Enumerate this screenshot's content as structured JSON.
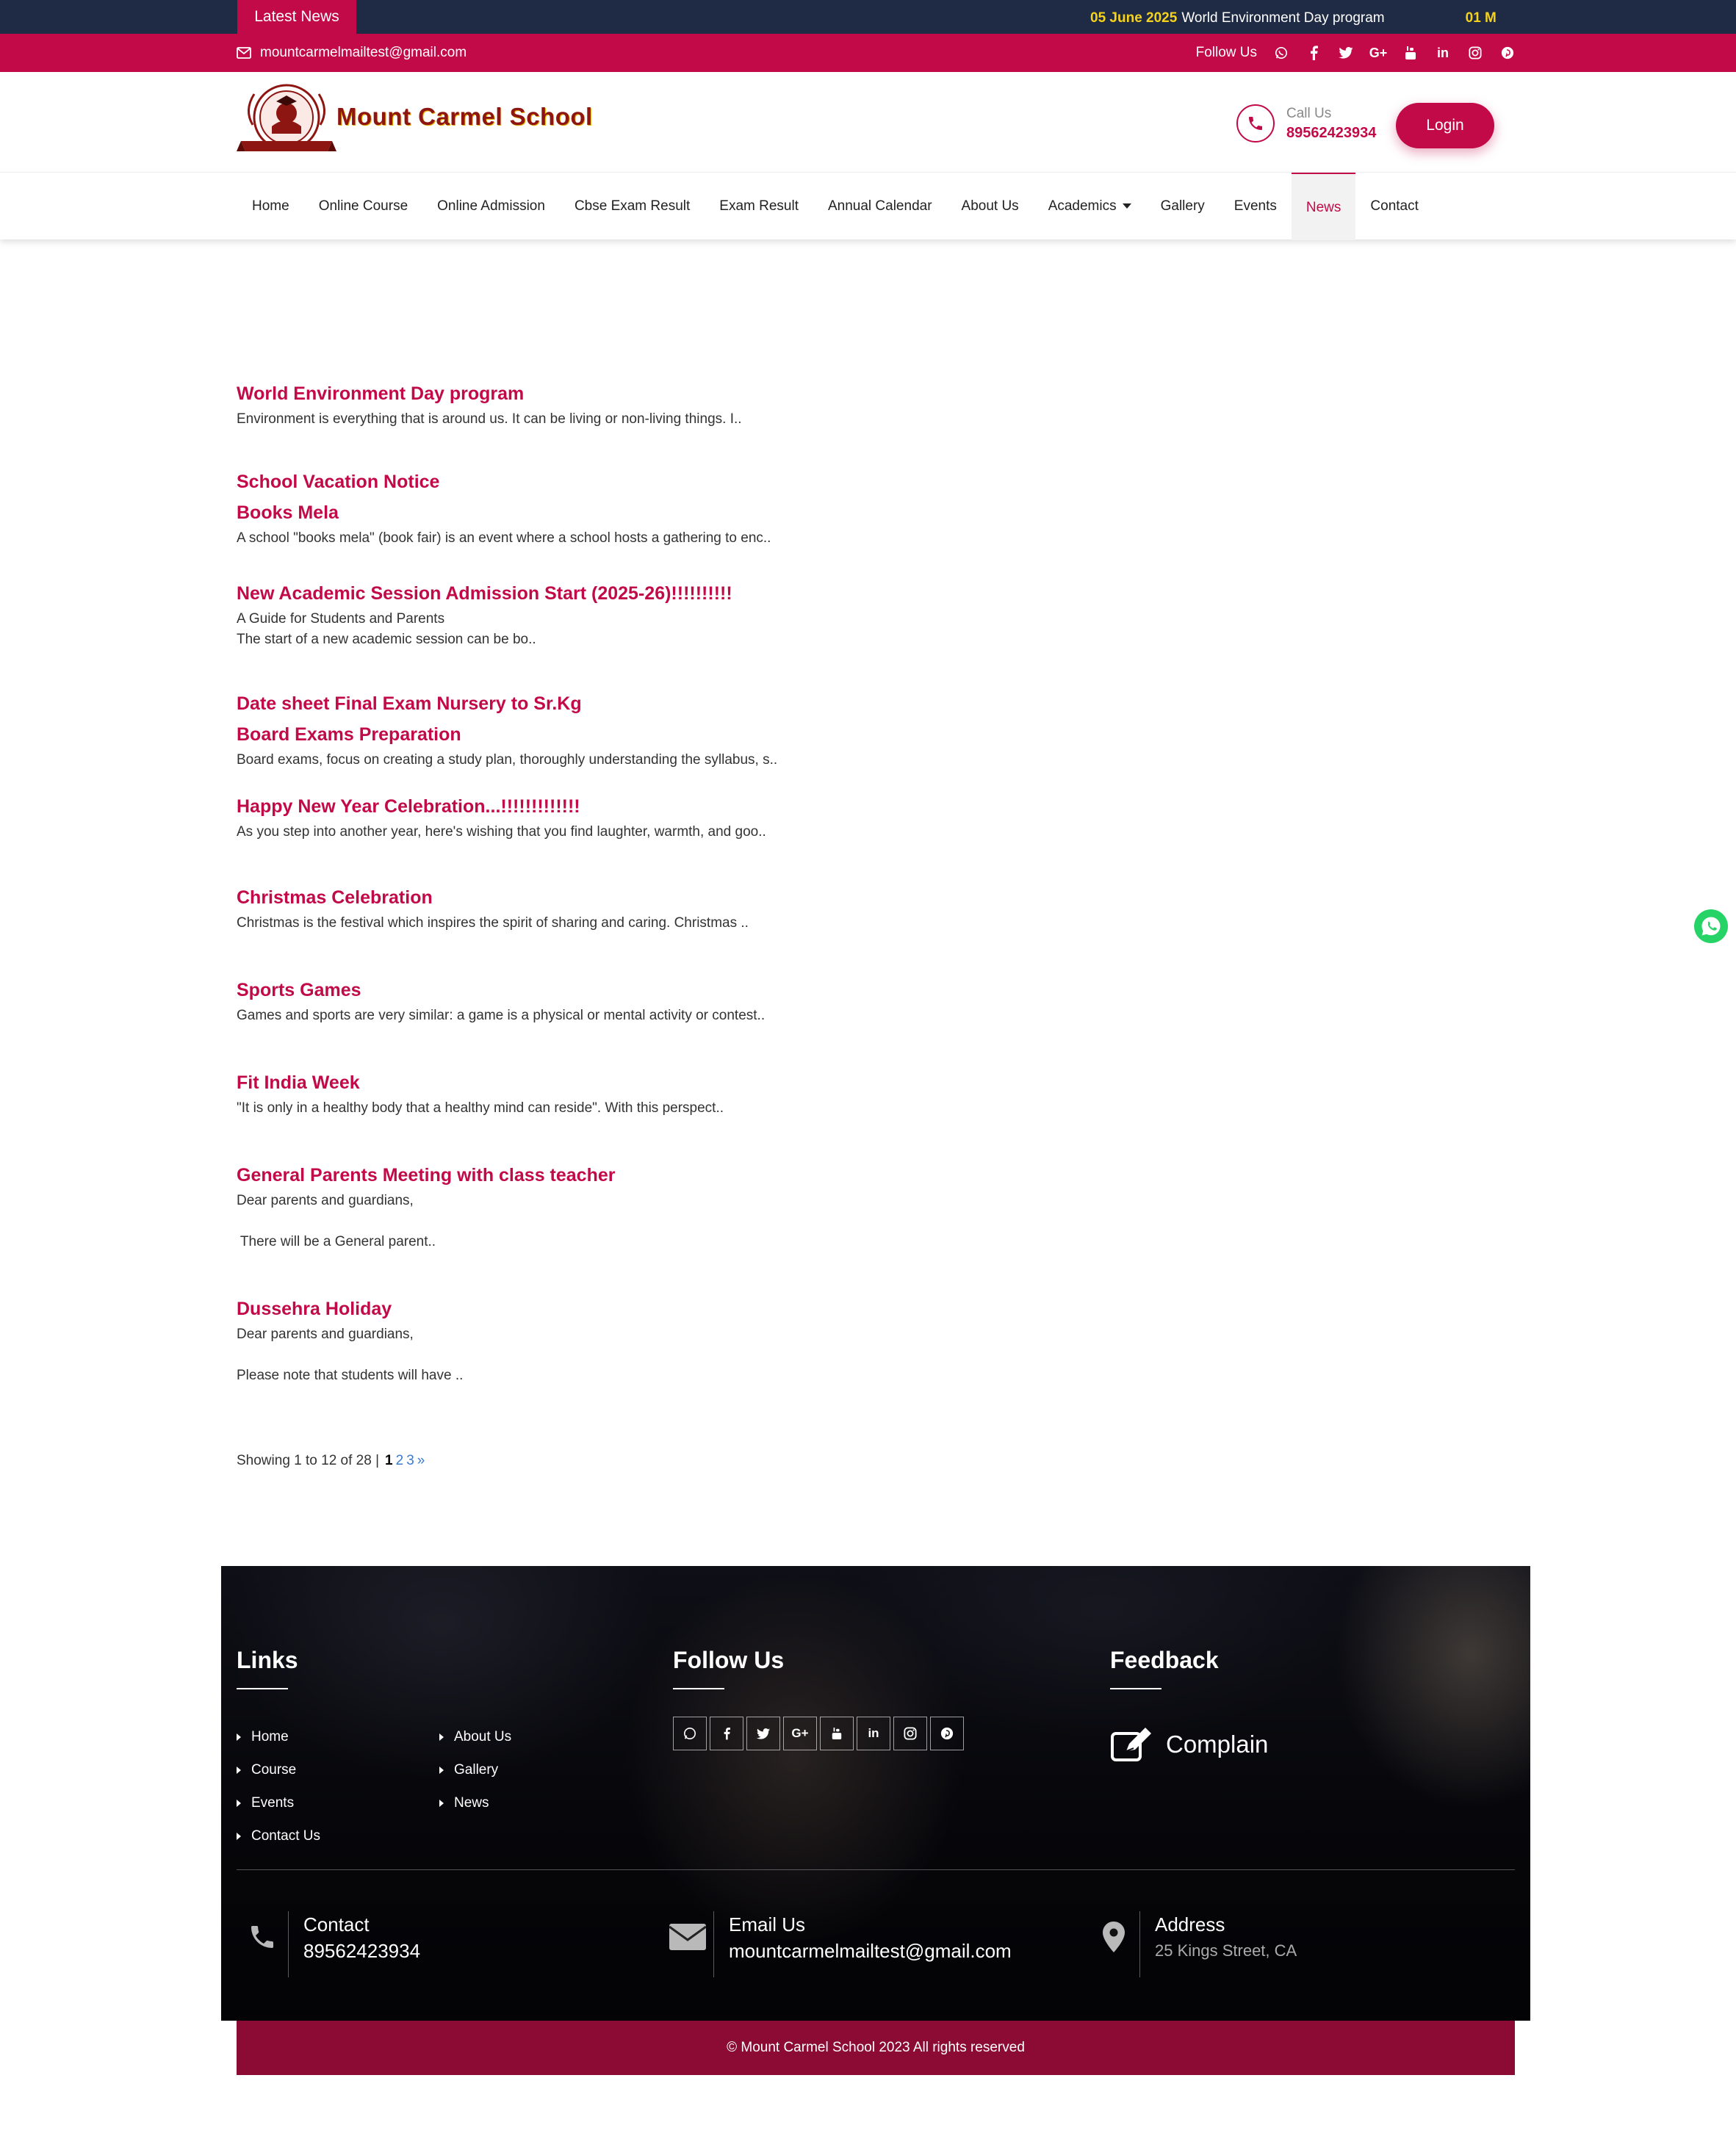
{
  "topbar": {
    "latest_label": "Latest News",
    "ticker": [
      {
        "date": "05 June 2025",
        "text": "World Environment Day program"
      },
      {
        "date": "01 M",
        "text": ""
      }
    ]
  },
  "contactbar": {
    "email": "mountcarmelmailtest@gmail.com",
    "follow_label": "Follow Us",
    "social_icons": [
      "whatsapp-icon",
      "facebook-icon",
      "twitter-icon",
      "google-plus-icon",
      "youtube-icon",
      "linkedin-icon",
      "instagram-icon",
      "pinterest-icon"
    ]
  },
  "header": {
    "school_name": "Mount Carmel School",
    "call_label": "Call Us",
    "phone": "89562423934",
    "login_label": "Login"
  },
  "nav": {
    "items": [
      "Home",
      "Online Course",
      "Online Admission",
      "Cbse Exam Result",
      "Exam Result",
      "Annual Calendar",
      "About Us",
      "Academics",
      "Gallery",
      "Events",
      "News",
      "Contact"
    ],
    "active": "News"
  },
  "news": [
    {
      "title": "World Environment Day program",
      "desc": [
        "Environment is everything that is around us. It can be living or non-living things. I.."
      ]
    },
    {
      "title": "School Vacation Notice",
      "desc": []
    },
    {
      "title": "Books Mela",
      "desc": [
        "A school \"books mela\" (book fair) is an event where a school hosts a gathering to enc.."
      ]
    },
    {
      "title": "New Academic Session Admission Start (2025-26)!!!!!!!!!!",
      "desc": [
        "A Guide for Students and Parents",
        "The start of a new academic session can be bo.."
      ]
    },
    {
      "title": "Date sheet Final Exam Nursery to Sr.Kg",
      "desc": []
    },
    {
      "title": "Board Exams Preparation",
      "desc": [
        "Board exams, focus on creating a study plan, thoroughly understanding the syllabus, s.."
      ]
    },
    {
      "title": "Happy New Year Celebration...!!!!!!!!!!!!!",
      "desc": [
        "As you step into another year, here's wishing that you find laughter, warmth, and goo.."
      ]
    },
    {
      "title": "Christmas Celebration",
      "desc": [
        "Christmas is the festival which inspires the spirit of sharing and caring. Christmas .."
      ]
    },
    {
      "title": "Sports Games",
      "desc": [
        "Games and sports are very similar: a game is a physical or mental activity or contest.."
      ]
    },
    {
      "title": "Fit India Week",
      "desc": [
        "\"It is only in a healthy body that a healthy mind can reside\". With this perspect.."
      ]
    },
    {
      "title": "General Parents Meeting with class teacher",
      "desc": [
        "Dear parents and guardians,",
        " There will be a General parent.."
      ]
    },
    {
      "title": "Dussehra Holiday",
      "desc": [
        "Dear parents and guardians,",
        "Please note that students will have .."
      ]
    }
  ],
  "pagination": {
    "summary": "Showing 1 to 12 of 28 |",
    "current": "1",
    "pages": [
      "2",
      "3",
      "»"
    ]
  },
  "footer": {
    "links_heading": "Links",
    "links_col1": [
      "Home",
      "Course",
      "Events",
      "Contact Us"
    ],
    "links_col2": [
      "About Us",
      "Gallery",
      "News"
    ],
    "follow_heading": "Follow Us",
    "feedback_heading": "Feedback",
    "complain_label": "Complain",
    "contact_label": "Contact",
    "contact_value": "89562423934",
    "email_label": "Email Us",
    "email_value": "mountcarmelmailtest@gmail.com",
    "address_label": "Address",
    "address_value": "25 Kings Street, CA",
    "copyright": "© Mount Carmel School 2023 All rights reserved"
  },
  "colors": {
    "brand": "#c20a48",
    "topbar": "#1f2a44",
    "copyright_bg": "#8b0b34",
    "ticker_date": "#f5d21b"
  }
}
